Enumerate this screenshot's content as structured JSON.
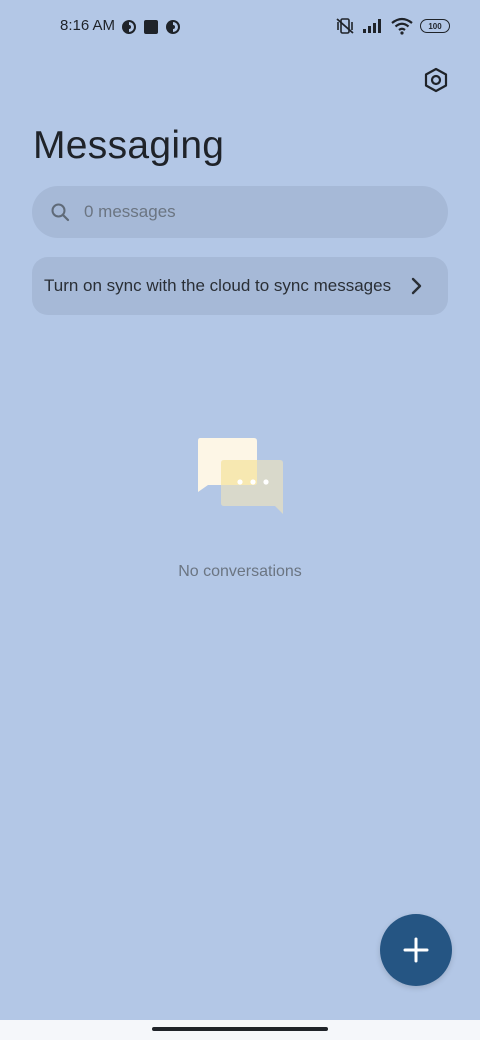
{
  "status_bar": {
    "time": "8:16 AM",
    "battery": "100",
    "left_icons": [
      "app-notification-icon",
      "square-notification-icon",
      "app-notification-icon"
    ],
    "right_icons": [
      "vibrate-off-icon",
      "signal-icon",
      "wifi-icon",
      "battery-icon"
    ]
  },
  "header": {
    "title": "Messaging",
    "settings_icon": "settings-icon"
  },
  "search": {
    "placeholder": "0 messages",
    "icon": "search-icon"
  },
  "sync_banner": {
    "text": "Turn on sync with the cloud to sync messages",
    "icon": "chevron-right-icon"
  },
  "empty_state": {
    "icon": "chat-bubbles-icon",
    "text": "No conversations"
  },
  "fab": {
    "icon": "plus-icon",
    "color": "#255583"
  },
  "colors": {
    "background": "#b3c7e6",
    "surface": "#a6b9d7",
    "accent": "#255583"
  }
}
